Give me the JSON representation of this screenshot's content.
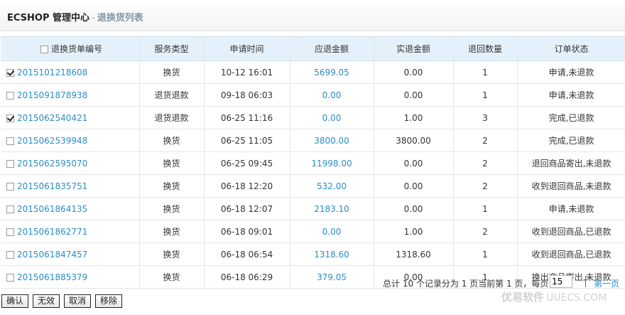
{
  "header": {
    "brand": "ECSHOP 管理中心",
    "separator": "-",
    "page": "退换货列表"
  },
  "table": {
    "columns": [
      "退换货单编号",
      "服务类型",
      "申请时间",
      "应退金额",
      "实退金额",
      "退回数量",
      "订单状态"
    ],
    "rows": [
      {
        "checked": true,
        "id": "2015101218608",
        "service": "换货",
        "time": "10-12 16:01",
        "due": "5699.05",
        "refunded": "0.00",
        "qty": "1",
        "status": "申请,未退款"
      },
      {
        "checked": false,
        "id": "2015091878938",
        "service": "退货退款",
        "time": "09-18 06:03",
        "due": "0.00",
        "refunded": "0.00",
        "qty": "1",
        "status": "申请,未退款"
      },
      {
        "checked": true,
        "id": "2015062540421",
        "service": "退货退款",
        "time": "06-25 11:16",
        "due": "0.00",
        "refunded": "1.00",
        "qty": "3",
        "status": "完成,已退款"
      },
      {
        "checked": false,
        "id": "2015062539948",
        "service": "换货",
        "time": "06-25 11:05",
        "due": "3800.00",
        "refunded": "3800.00",
        "qty": "2",
        "status": "完成,已退款"
      },
      {
        "checked": false,
        "id": "2015062595070",
        "service": "换货",
        "time": "06-25 09:45",
        "due": "11998.00",
        "refunded": "0.00",
        "qty": "2",
        "status": "退回商品寄出,未退款"
      },
      {
        "checked": false,
        "id": "2015061835751",
        "service": "换货",
        "time": "06-18 12:20",
        "due": "532.00",
        "refunded": "0.00",
        "qty": "2",
        "status": "收到退回商品,未退款"
      },
      {
        "checked": false,
        "id": "2015061864135",
        "service": "换货",
        "time": "06-18 12:07",
        "due": "2183.10",
        "refunded": "0.00",
        "qty": "1",
        "status": "申请,未退款"
      },
      {
        "checked": false,
        "id": "2015061862771",
        "service": "换货",
        "time": "06-18 09:01",
        "due": "0.00",
        "refunded": "1.00",
        "qty": "2",
        "status": "收到退回商品,已退款"
      },
      {
        "checked": false,
        "id": "2015061847457",
        "service": "换货",
        "time": "06-18 06:54",
        "due": "1318.60",
        "refunded": "1318.60",
        "qty": "1",
        "status": "收到退回商品,已退款"
      },
      {
        "checked": false,
        "id": "2015061885379",
        "service": "换货",
        "time": "06-18 06:29",
        "due": "379.05",
        "refunded": "0.00",
        "qty": "1",
        "status": "换出商品寄出,未退款"
      }
    ]
  },
  "pager": {
    "summary": "总计 10 个记录分为 1 页当前第 1 页，每页",
    "page_size": "15",
    "first_page": "第一页"
  },
  "actions": {
    "confirm": "确认",
    "invalid": "无效",
    "cancel": "取消",
    "remove": "移除"
  },
  "watermark": {
    "name": "优易软件",
    "site": "UUECS.COM"
  },
  "colors": {
    "link": "#2a8ec7",
    "header_row": "#e4f1fb"
  }
}
